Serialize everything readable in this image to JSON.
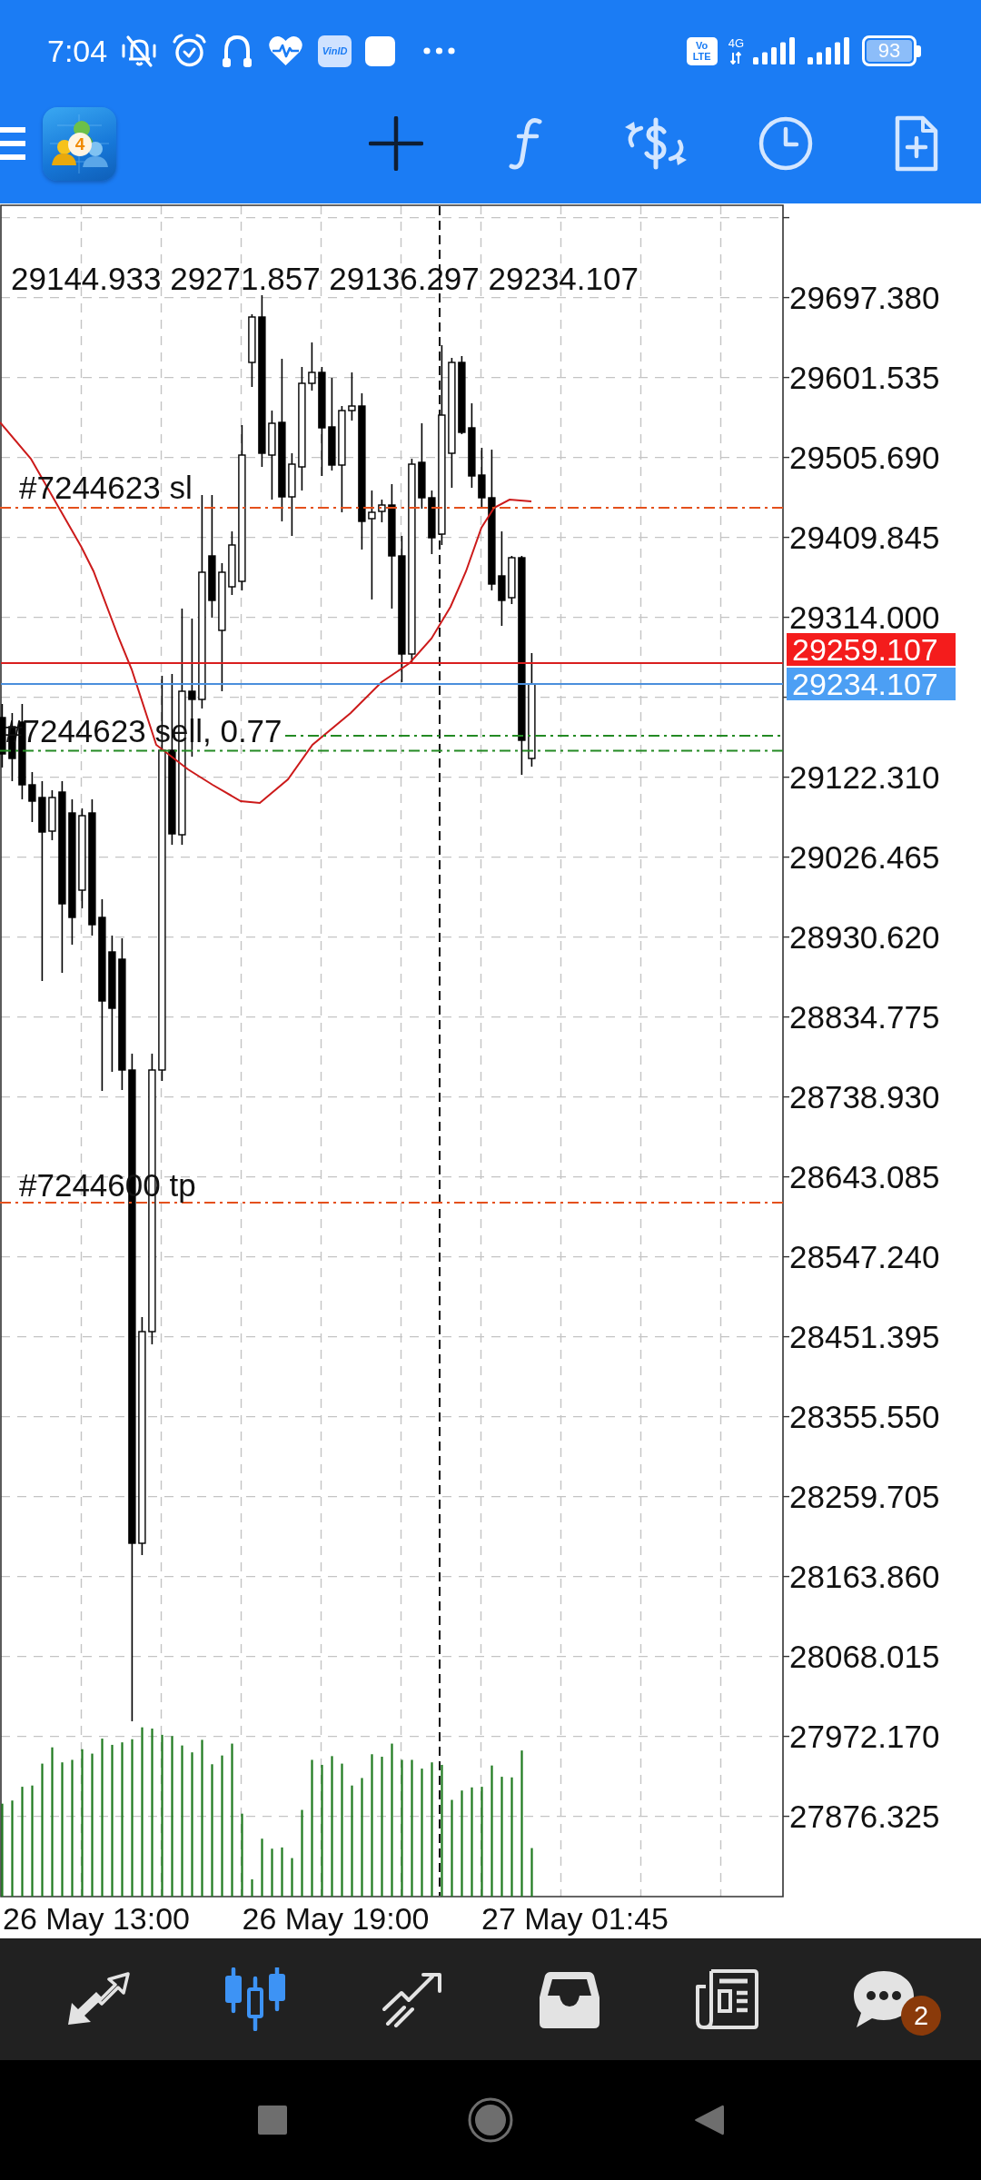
{
  "status_bar": {
    "time": "7:04",
    "app_badge": "VinID",
    "volte": [
      "Vo",
      "LTE"
    ],
    "network_type": "4G",
    "battery": "93"
  },
  "toolbar": {
    "logo_number": "4",
    "tools": [
      {
        "kind": "crosshair",
        "selected": true
      },
      {
        "kind": "function",
        "selected": false
      },
      {
        "kind": "dollar-exchange",
        "selected": false
      },
      {
        "kind": "clock",
        "selected": false
      },
      {
        "kind": "file-plus",
        "selected": false
      }
    ]
  },
  "chart": {
    "ohlc": "29144.933 29271.857 29136.297 29234.107",
    "orders": [
      {
        "kind": "stop-loss",
        "label": "#7244623 sl"
      },
      {
        "kind": "entry",
        "label": "#7244623 sell, 0.77"
      },
      {
        "kind": "take-profit",
        "label": "#7244600 tp"
      }
    ],
    "price_axis": {
      "above_quote": [
        "29697.380",
        "29601.535",
        "29505.690",
        "29409.845",
        "29314.000"
      ],
      "below_quote": [
        "29122.310",
        "29026.465",
        "28930.620",
        "28834.775",
        "28738.930",
        "28643.085",
        "28547.240",
        "28451.395",
        "28355.550",
        "28259.705",
        "28163.860",
        "28068.015",
        "27972.170",
        "27876.325"
      ]
    },
    "quote": {
      "ask": "29259.107",
      "bid": "29234.107"
    },
    "time_axis": [
      "26 May 13:00",
      "26 May 19:00",
      "27 May 01:45"
    ]
  },
  "bottom_nav": [
    {
      "kind": "arrows",
      "selected": false
    },
    {
      "kind": "candles",
      "selected": true
    },
    {
      "kind": "trend",
      "selected": false
    },
    {
      "kind": "tray",
      "selected": false
    },
    {
      "kind": "newspaper",
      "selected": false
    },
    {
      "kind": "chat",
      "selected": false,
      "badge": "2"
    }
  ]
}
